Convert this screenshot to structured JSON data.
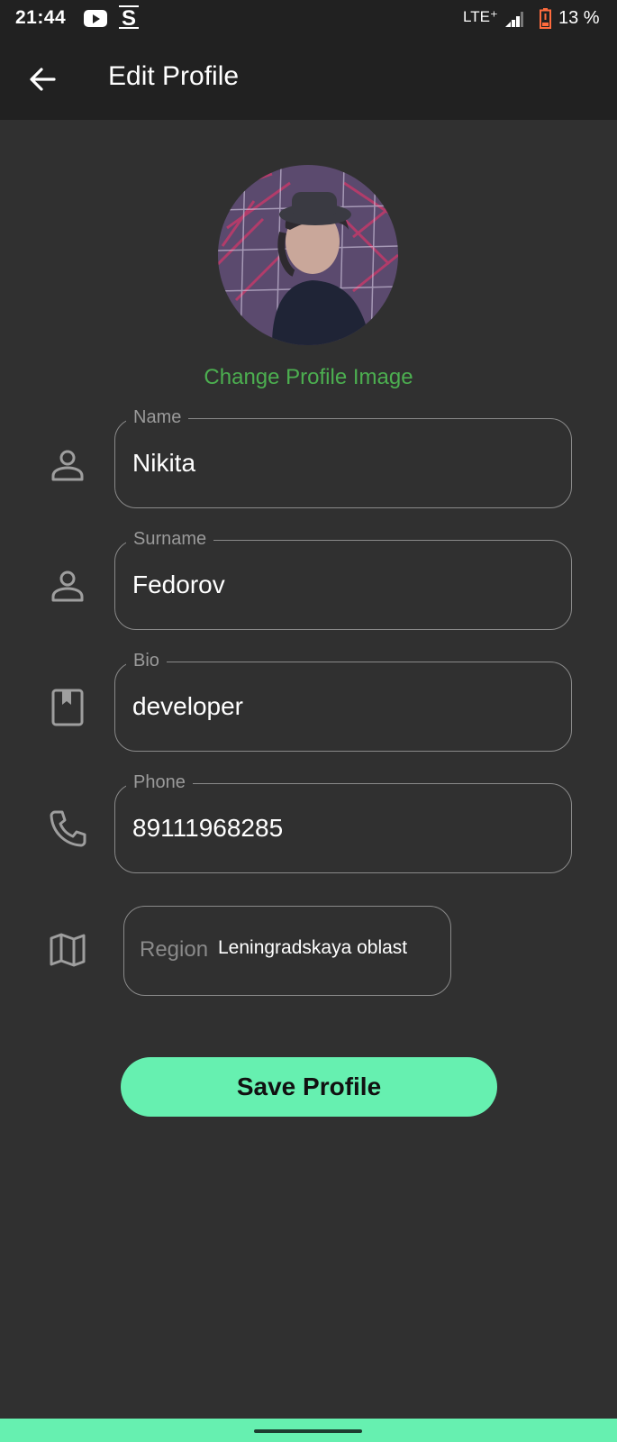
{
  "status_bar": {
    "time": "21:44",
    "network": "LTE⁺",
    "battery_percent": "13 %",
    "icons": [
      "youtube-icon",
      "s-app-icon",
      "signal-icon",
      "battery-low-icon"
    ]
  },
  "app_bar": {
    "title": "Edit Profile",
    "back_icon": "arrow-back-icon"
  },
  "profile": {
    "avatar_icon": "profile-photo",
    "change_image_label": "Change Profile Image"
  },
  "fields": [
    {
      "label": "Name",
      "value": "Nikita",
      "icon": "person-outline-icon"
    },
    {
      "label": "Surname",
      "value": "Fedorov",
      "icon": "person-outline-icon"
    },
    {
      "label": "Bio",
      "value": "developer",
      "icon": "book-icon"
    },
    {
      "label": "Phone",
      "value": "89111968285",
      "icon": "phone-icon"
    }
  ],
  "region": {
    "label": "Region",
    "value": "Leningradskaya oblast",
    "icon": "map-icon"
  },
  "save_button": {
    "label": "Save Profile"
  },
  "colors": {
    "background": "#303030",
    "app_bar": "#212121",
    "accent_green": "#66f0b0",
    "link_green": "#4caf50"
  }
}
